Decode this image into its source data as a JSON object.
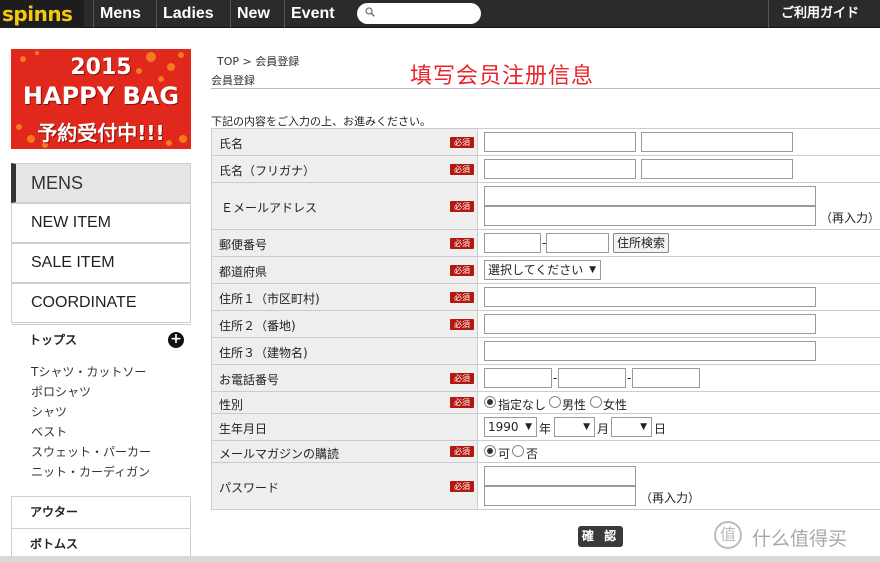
{
  "header": {
    "logo": "spinns",
    "nav": [
      "Mens",
      "Ladies",
      "New",
      "Event"
    ],
    "search_placeholder": "",
    "guide": "ご利用ガイド"
  },
  "banner": {
    "year": "2015",
    "title": "HAPPY BAG",
    "subtitle": "予約受付中!!!"
  },
  "sidebar": {
    "mens": "MENS",
    "items": [
      "NEW ITEM",
      "SALE ITEM",
      "COORDINATE"
    ],
    "tops": "トップス",
    "tops_sub": [
      "Tシャツ・カットソー",
      "ポロシャツ",
      "シャツ",
      "ベスト",
      "スウェット・パーカー",
      "ニット・カーディガン"
    ],
    "outer": "アウター",
    "bottoms": "ボトムス"
  },
  "main": {
    "breadcrumb": "TOP > 会員登録",
    "page_label": "会員登録",
    "overlay_title": "填写会员注册信息",
    "intro": "下記の内容をご入力の上、お進みください。",
    "required": "必須",
    "fields": {
      "name": "氏名",
      "kana": "氏名（フリガナ）",
      "email": "Ｅメールアドレス",
      "zip": "郵便番号",
      "pref": "都道府県",
      "addr1": "住所１（市区町村)",
      "addr2": "住所２（番地)",
      "addr3": "住所３（建物名)",
      "tel": "お電話番号",
      "gender": "性別",
      "birth": "生年月日",
      "magazine": "メールマガジンの購読",
      "password": "パスワード"
    },
    "reenter": "（再入力）",
    "zip_search": "住所検索",
    "pref_select": "選択してください",
    "gender_options": [
      "指定なし",
      "男性",
      "女性"
    ],
    "birth_year": "1990",
    "birth_year_unit": "年",
    "birth_month_unit": "月",
    "birth_day_unit": "日",
    "magazine_options": [
      "可",
      "否"
    ],
    "confirm": "確 認"
  },
  "watermark": {
    "badge": "值",
    "text": "什么值得买"
  }
}
